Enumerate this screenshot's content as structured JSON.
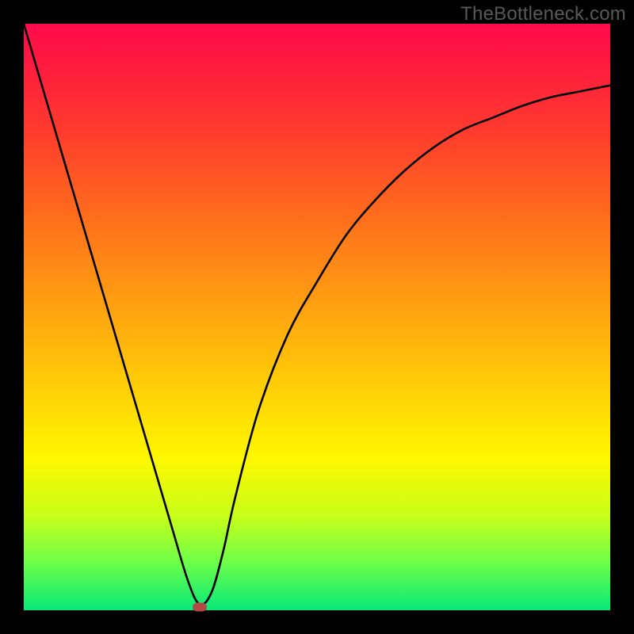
{
  "watermark": "TheBottleneck.com",
  "chart_data": {
    "type": "line",
    "title": "",
    "xlabel": "",
    "ylabel": "",
    "xlim": [
      0,
      1
    ],
    "ylim": [
      0,
      1
    ],
    "x": [
      0.0,
      0.05,
      0.1,
      0.15,
      0.2,
      0.25,
      0.28,
      0.3,
      0.32,
      0.34,
      0.36,
      0.4,
      0.45,
      0.5,
      0.55,
      0.6,
      0.65,
      0.7,
      0.75,
      0.8,
      0.85,
      0.9,
      0.95,
      1.0
    ],
    "y": [
      1.0,
      0.83,
      0.66,
      0.49,
      0.32,
      0.15,
      0.05,
      0.01,
      0.03,
      0.1,
      0.19,
      0.34,
      0.47,
      0.56,
      0.64,
      0.7,
      0.75,
      0.79,
      0.82,
      0.84,
      0.86,
      0.875,
      0.885,
      0.895
    ],
    "marker": {
      "x": 0.3,
      "y": 0.005
    },
    "gradient_stops": [
      {
        "pos": 0.0,
        "color": "#ff0b4e"
      },
      {
        "pos": 0.18,
        "color": "#ff3a2e"
      },
      {
        "pos": 0.46,
        "color": "#ff9a12"
      },
      {
        "pos": 0.74,
        "color": "#fff700"
      },
      {
        "pos": 0.92,
        "color": "#6bff4a"
      },
      {
        "pos": 1.0,
        "color": "#07e878"
      }
    ]
  }
}
